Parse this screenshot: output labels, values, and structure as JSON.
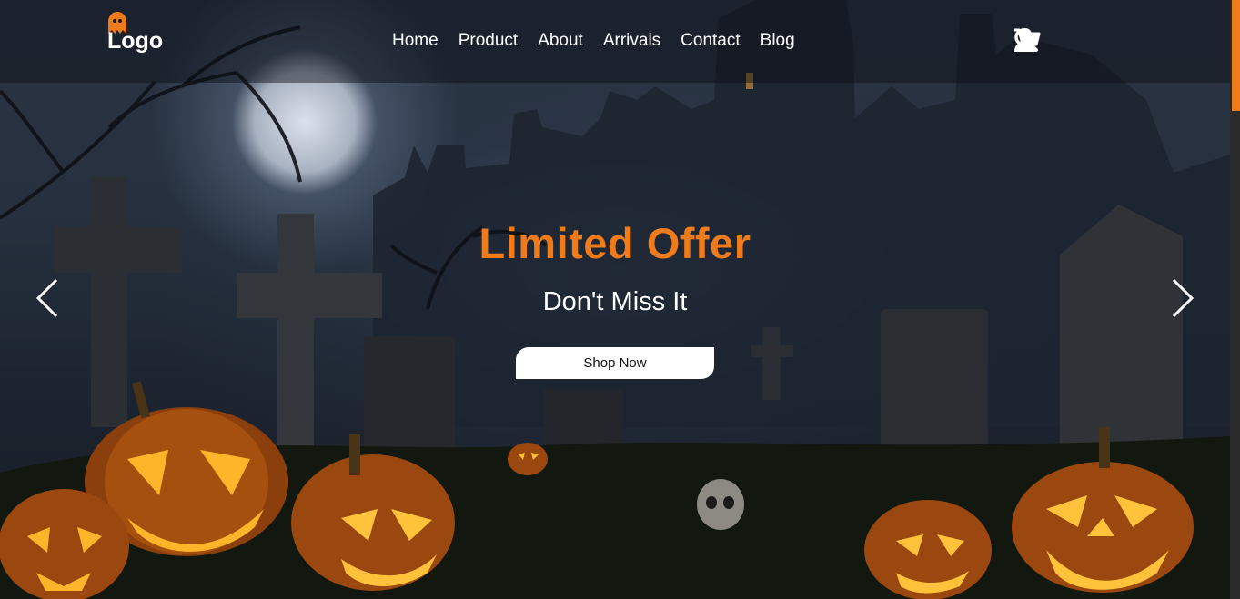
{
  "header": {
    "logo_text": "Logo",
    "nav": [
      "Home",
      "Product",
      "About",
      "Arrivals",
      "Contact",
      "Blog"
    ]
  },
  "hero": {
    "title": "Limited Offer",
    "subtitle": "Don't Miss It",
    "button_label": "Shop Now"
  },
  "icons": [
    "ghost-icon",
    "search-icon",
    "cart-icon",
    "user-icon",
    "chevron-left-icon",
    "chevron-right-icon"
  ],
  "colors": {
    "accent": "#ef7b1a",
    "text": "#ffffff",
    "button_bg": "#ffffff"
  }
}
